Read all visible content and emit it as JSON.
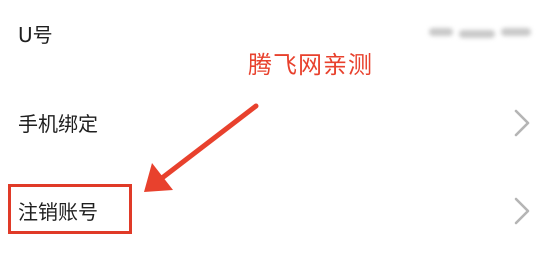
{
  "rows": {
    "uid": {
      "label": "U号"
    },
    "phone": {
      "label": "手机绑定"
    },
    "cancel": {
      "label": "注销账号"
    }
  },
  "annotation": {
    "text": "腾飞网亲测",
    "color": "#e8412d"
  },
  "icons": {
    "chevron": "chevron-right-icon"
  }
}
